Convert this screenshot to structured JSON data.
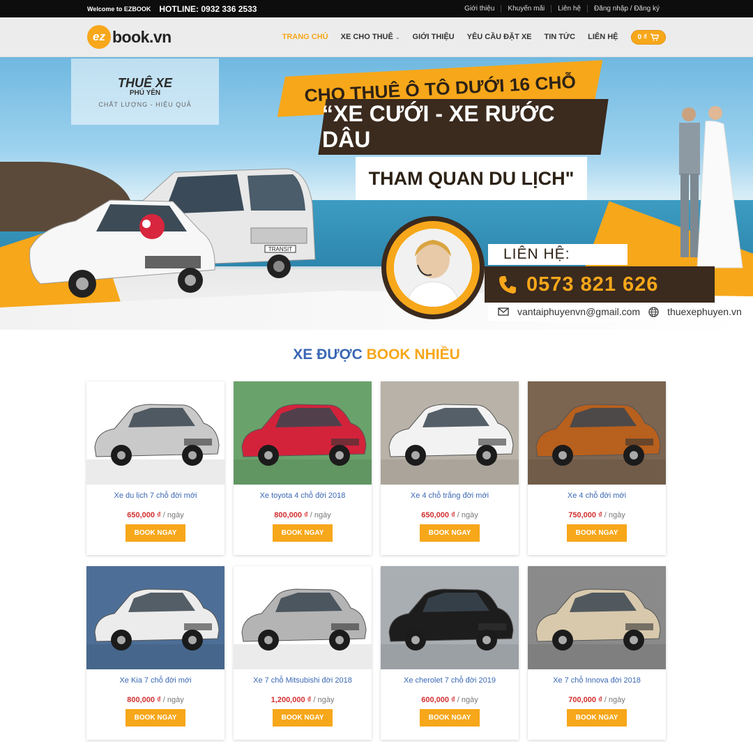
{
  "topbar": {
    "welcome": "Welcome to EZBOOK",
    "hotline": "HOTLINE: 0932 336 2533",
    "links": [
      "Giới thiệu",
      "Khuyến mãi",
      "Liên hệ",
      "Đăng nhập / Đăng ký"
    ]
  },
  "header": {
    "logo_mark": "ez",
    "logo_text": "book.vn",
    "nav": [
      {
        "label": "TRANG CHỦ",
        "active": true
      },
      {
        "label": "XE CHO THUÊ",
        "dropdown": true
      },
      {
        "label": "GIỚI THIỆU"
      },
      {
        "label": "YÊU CẦU ĐẶT XE"
      },
      {
        "label": "TIN TỨC"
      },
      {
        "label": "LIÊN HỆ"
      }
    ],
    "cart_total": "0 ₫",
    "cart_icon": "cart-icon"
  },
  "banner": {
    "logo_title": "THUÊ XE",
    "logo_subtitle": "PHÚ YÊN",
    "logo_tagline": "CHẤT LƯỢNG - HIỆU QUẢ",
    "line1": "CHO THUÊ Ô TÔ DƯỚI 16 CHỖ",
    "line2": "“XE CƯỚI - XE RƯỚC DÂU",
    "line3": "THAM QUAN DU LỊCH\"",
    "contact_label": "LIÊN HỆ:",
    "phone": "0573 821 626",
    "email": "vantaiphuyenvn@gmail.com",
    "website": "thuexephuyen.vn",
    "van_badge": "TRANSIT"
  },
  "section": {
    "title_part1": "XE ĐƯỢC",
    "title_part2": "BOOK NHIỀU"
  },
  "colors": {
    "accent": "#f7a71a",
    "link_blue": "#3a67b4",
    "price_red": "#d32f2f",
    "dark_brown": "#3b2a1e"
  },
  "products": [
    {
      "name": "Xe du lịch 7 chỗ đời mới",
      "price": "650,000 ₫",
      "unit": "/ ngày",
      "button": "BOOK NGAY",
      "car_color": "#c9c9c9",
      "bg": "#ffffff"
    },
    {
      "name": "Xe toyota 4 chỗ đời 2018",
      "price": "800,000 ₫",
      "unit": "/ ngày",
      "button": "BOOK NGAY",
      "car_color": "#d3233b",
      "bg": "#6aa26b"
    },
    {
      "name": "Xe 4 chỗ trắng đời mới",
      "price": "650,000 ₫",
      "unit": "/ ngày",
      "button": "BOOK NGAY",
      "car_color": "#f2f2f2",
      "bg": "#b9b2a8"
    },
    {
      "name": "Xe 4 chỗ đời mới",
      "price": "750,000 ₫",
      "unit": "/ ngày",
      "button": "BOOK NGAY",
      "car_color": "#b8601d",
      "bg": "#7b6450"
    },
    {
      "name": "Xe Kia 7 chỗ đời mới",
      "price": "800,000 ₫",
      "unit": "/ ngày",
      "button": "BOOK NGAY",
      "car_color": "#ececec",
      "bg": "#4d6f97"
    },
    {
      "name": "Xe 7 chỗ Mitsubishi đời 2018",
      "price": "1,200,000 ₫",
      "unit": "/ ngày",
      "button": "BOOK NGAY",
      "car_color": "#b4b4b4",
      "bg": "#ffffff"
    },
    {
      "name": "Xe cherolet 7 chỗ đời 2019",
      "price": "600,000 ₫",
      "unit": "/ ngày",
      "button": "BOOK NGAY",
      "car_color": "#1d1d1d",
      "bg": "#a9aeb3"
    },
    {
      "name": "Xe 7 chỗ Innova đời 2018",
      "price": "700,000 ₫",
      "unit": "/ ngày",
      "button": "BOOK NGAY",
      "car_color": "#d8c9ad",
      "bg": "#8a8a8a"
    }
  ]
}
